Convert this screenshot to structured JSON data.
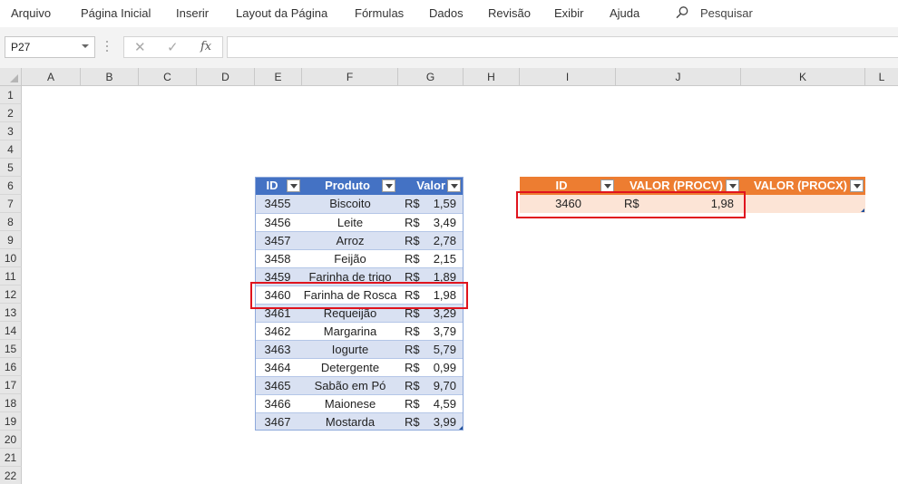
{
  "menu": [
    "Arquivo",
    "Página Inicial",
    "Inserir",
    "Layout da Página",
    "Fórmulas",
    "Dados",
    "Revisão",
    "Exibir",
    "Ajuda"
  ],
  "search": {
    "label": "Pesquisar",
    "icon": "search-icon"
  },
  "formula_bar": {
    "namebox": "P27",
    "cancel": "✕",
    "enter": "✓",
    "fx": "fx",
    "content": ""
  },
  "columns": [
    "A",
    "B",
    "C",
    "D",
    "E",
    "F",
    "G",
    "H",
    "I",
    "J",
    "K",
    "L"
  ],
  "rows": [
    "1",
    "2",
    "3",
    "4",
    "5",
    "6",
    "7",
    "8",
    "9",
    "10",
    "11",
    "12",
    "13",
    "14",
    "15",
    "16",
    "17",
    "18",
    "19",
    "20",
    "21",
    "22"
  ],
  "product_table": {
    "headers": {
      "id": "ID",
      "produto": "Produto",
      "valor": "Valor"
    },
    "currency": "R$",
    "rows": [
      {
        "id": "3455",
        "produto": "Biscoito",
        "valor": "1,59"
      },
      {
        "id": "3456",
        "produto": "Leite",
        "valor": "3,49"
      },
      {
        "id": "3457",
        "produto": "Arroz",
        "valor": "2,78"
      },
      {
        "id": "3458",
        "produto": "Feijão",
        "valor": "2,15"
      },
      {
        "id": "3459",
        "produto": "Farinha de trigo",
        "valor": "1,89"
      },
      {
        "id": "3460",
        "produto": "Farinha de Rosca",
        "valor": "1,98"
      },
      {
        "id": "3461",
        "produto": "Requeijão",
        "valor": "3,29"
      },
      {
        "id": "3462",
        "produto": "Margarina",
        "valor": "3,79"
      },
      {
        "id": "3463",
        "produto": "Iogurte",
        "valor": "5,79"
      },
      {
        "id": "3464",
        "produto": "Detergente",
        "valor": "0,99"
      },
      {
        "id": "3465",
        "produto": "Sabão em Pó",
        "valor": "9,70"
      },
      {
        "id": "3466",
        "produto": "Maionese",
        "valor": "4,59"
      },
      {
        "id": "3467",
        "produto": "Mostarda",
        "valor": "3,99"
      }
    ]
  },
  "lookup_table": {
    "headers": {
      "id": "ID",
      "procv": "VALOR (PROCV)",
      "procx": "VALOR (PROCX)"
    },
    "row": {
      "id": "3460",
      "currency": "R$",
      "procv": "1,98",
      "procx": ""
    }
  },
  "colors": {
    "blue_header": "#4472c4",
    "blue_band": "#d9e1f2",
    "orange_header": "#ed7d31",
    "orange_row": "#fce4d6",
    "highlight": "#e0141e"
  }
}
